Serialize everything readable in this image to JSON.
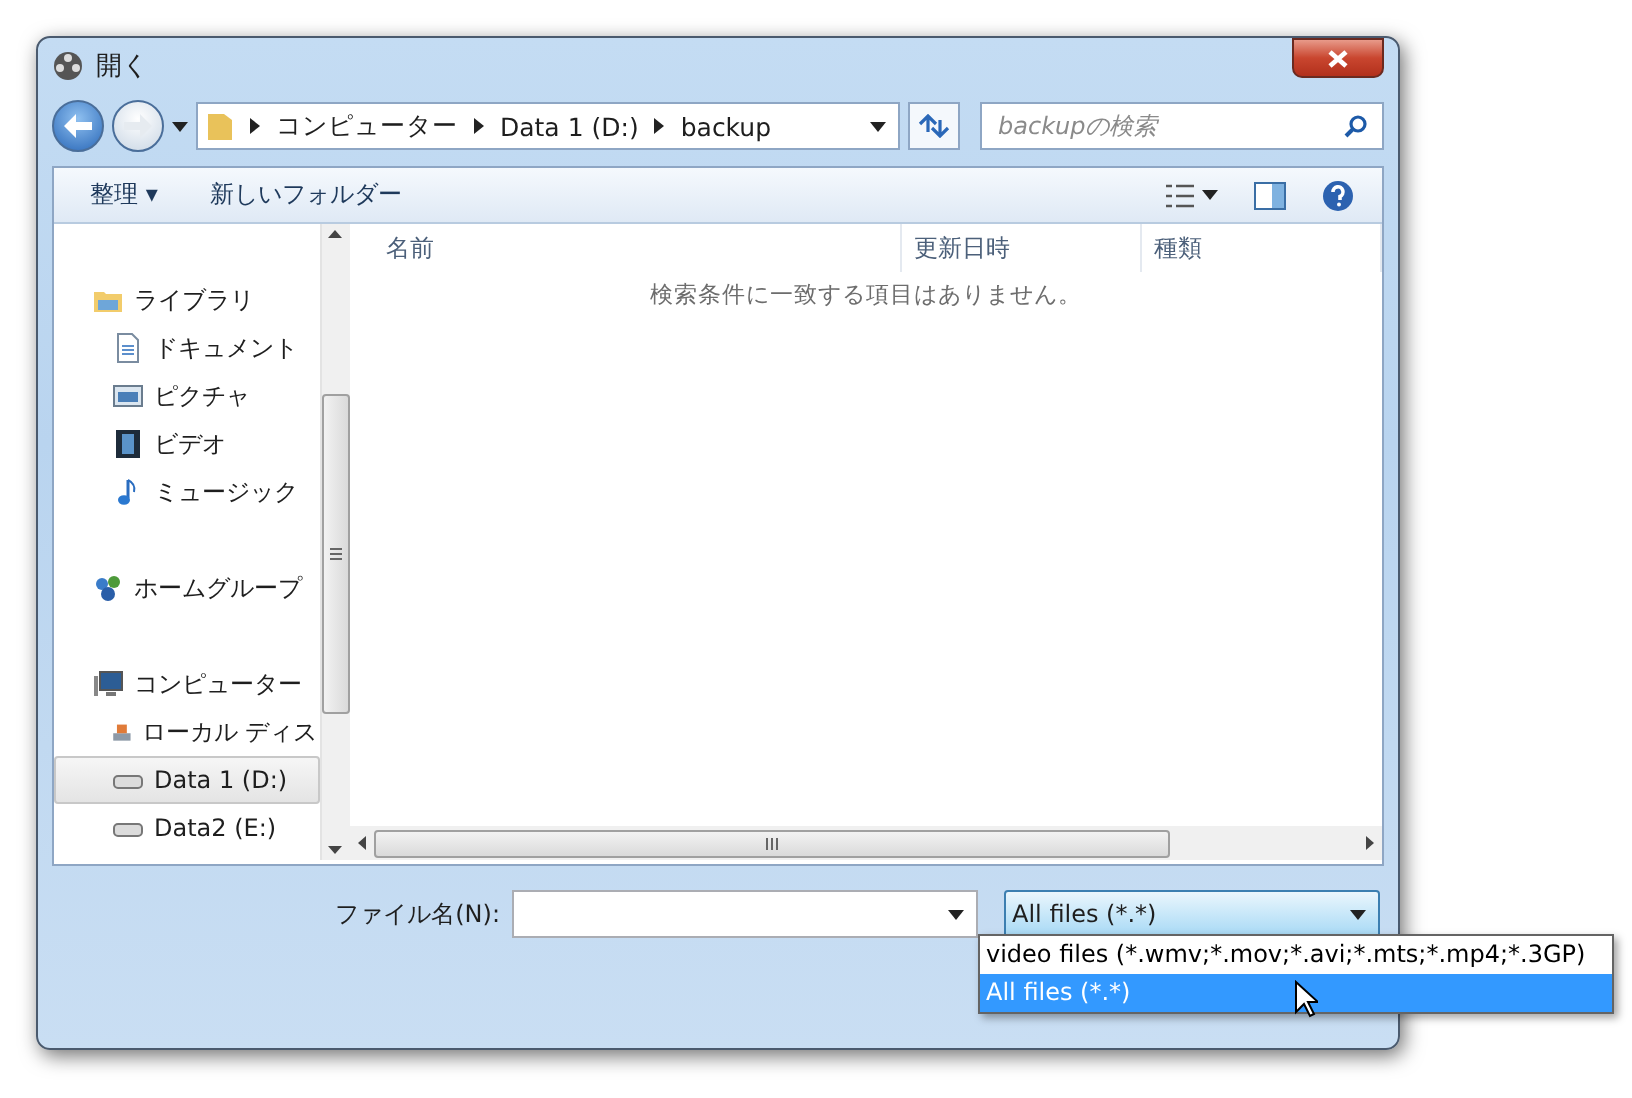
{
  "window": {
    "title": "開く"
  },
  "nav": {
    "path": [
      "コンピューター",
      "Data 1 (D:)",
      "backup"
    ],
    "search_placeholder": "backupの検索"
  },
  "toolbar": {
    "organize": "整理 ▾",
    "new_folder": "新しいフォルダー"
  },
  "sidebar": {
    "groups": [
      {
        "label": "ライブラリ",
        "kind": "library",
        "selected": false,
        "children": [
          {
            "label": "ドキュメント",
            "kind": "document",
            "selected": false
          },
          {
            "label": "ピクチャ",
            "kind": "picture",
            "selected": false
          },
          {
            "label": "ビデオ",
            "kind": "video",
            "selected": false
          },
          {
            "label": "ミュージック",
            "kind": "music",
            "selected": false
          }
        ]
      },
      {
        "label": "ホームグループ",
        "kind": "homegroup",
        "selected": false
      },
      {
        "label": "コンピューター",
        "kind": "computer",
        "selected": false,
        "children": [
          {
            "label": "ローカル ディス",
            "kind": "system-drive",
            "selected": false
          },
          {
            "label": "Data 1 (D:)",
            "kind": "drive",
            "selected": true
          },
          {
            "label": "Data2 (E:)",
            "kind": "drive",
            "selected": false
          }
        ]
      }
    ]
  },
  "table": {
    "columns": [
      "名前",
      "更新日時",
      "種類"
    ],
    "empty_message": "検索条件に一致する項目はありません。"
  },
  "footer": {
    "filename_label": "ファイル名(N):",
    "filetype": "All files  (*.*)",
    "filetype_options": [
      {
        "label": "video files  (*.wmv;*.mov;*.avi;*.mts;*.mp4;*.3GP)",
        "selected": false
      },
      {
        "label": "All files  (*.*)",
        "selected": true
      }
    ]
  }
}
